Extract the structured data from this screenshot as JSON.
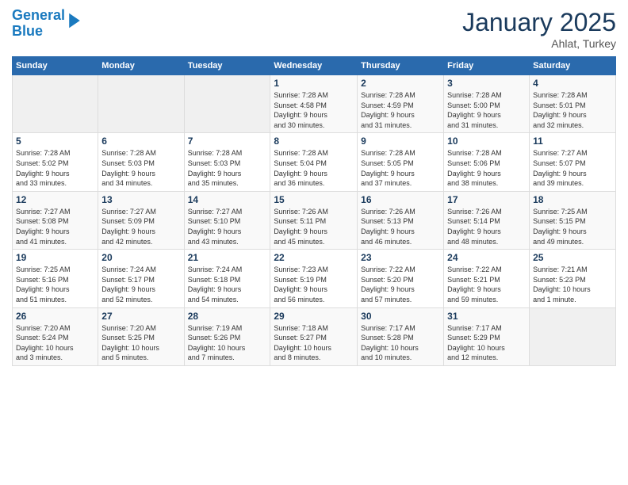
{
  "logo": {
    "line1": "General",
    "line2": "Blue"
  },
  "header": {
    "month": "January 2025",
    "location": "Ahlat, Turkey"
  },
  "days_of_week": [
    "Sunday",
    "Monday",
    "Tuesday",
    "Wednesday",
    "Thursday",
    "Friday",
    "Saturday"
  ],
  "weeks": [
    [
      {
        "day": "",
        "info": ""
      },
      {
        "day": "",
        "info": ""
      },
      {
        "day": "",
        "info": ""
      },
      {
        "day": "1",
        "info": "Sunrise: 7:28 AM\nSunset: 4:58 PM\nDaylight: 9 hours\nand 30 minutes."
      },
      {
        "day": "2",
        "info": "Sunrise: 7:28 AM\nSunset: 4:59 PM\nDaylight: 9 hours\nand 31 minutes."
      },
      {
        "day": "3",
        "info": "Sunrise: 7:28 AM\nSunset: 5:00 PM\nDaylight: 9 hours\nand 31 minutes."
      },
      {
        "day": "4",
        "info": "Sunrise: 7:28 AM\nSunset: 5:01 PM\nDaylight: 9 hours\nand 32 minutes."
      }
    ],
    [
      {
        "day": "5",
        "info": "Sunrise: 7:28 AM\nSunset: 5:02 PM\nDaylight: 9 hours\nand 33 minutes."
      },
      {
        "day": "6",
        "info": "Sunrise: 7:28 AM\nSunset: 5:03 PM\nDaylight: 9 hours\nand 34 minutes."
      },
      {
        "day": "7",
        "info": "Sunrise: 7:28 AM\nSunset: 5:03 PM\nDaylight: 9 hours\nand 35 minutes."
      },
      {
        "day": "8",
        "info": "Sunrise: 7:28 AM\nSunset: 5:04 PM\nDaylight: 9 hours\nand 36 minutes."
      },
      {
        "day": "9",
        "info": "Sunrise: 7:28 AM\nSunset: 5:05 PM\nDaylight: 9 hours\nand 37 minutes."
      },
      {
        "day": "10",
        "info": "Sunrise: 7:28 AM\nSunset: 5:06 PM\nDaylight: 9 hours\nand 38 minutes."
      },
      {
        "day": "11",
        "info": "Sunrise: 7:27 AM\nSunset: 5:07 PM\nDaylight: 9 hours\nand 39 minutes."
      }
    ],
    [
      {
        "day": "12",
        "info": "Sunrise: 7:27 AM\nSunset: 5:08 PM\nDaylight: 9 hours\nand 41 minutes."
      },
      {
        "day": "13",
        "info": "Sunrise: 7:27 AM\nSunset: 5:09 PM\nDaylight: 9 hours\nand 42 minutes."
      },
      {
        "day": "14",
        "info": "Sunrise: 7:27 AM\nSunset: 5:10 PM\nDaylight: 9 hours\nand 43 minutes."
      },
      {
        "day": "15",
        "info": "Sunrise: 7:26 AM\nSunset: 5:11 PM\nDaylight: 9 hours\nand 45 minutes."
      },
      {
        "day": "16",
        "info": "Sunrise: 7:26 AM\nSunset: 5:13 PM\nDaylight: 9 hours\nand 46 minutes."
      },
      {
        "day": "17",
        "info": "Sunrise: 7:26 AM\nSunset: 5:14 PM\nDaylight: 9 hours\nand 48 minutes."
      },
      {
        "day": "18",
        "info": "Sunrise: 7:25 AM\nSunset: 5:15 PM\nDaylight: 9 hours\nand 49 minutes."
      }
    ],
    [
      {
        "day": "19",
        "info": "Sunrise: 7:25 AM\nSunset: 5:16 PM\nDaylight: 9 hours\nand 51 minutes."
      },
      {
        "day": "20",
        "info": "Sunrise: 7:24 AM\nSunset: 5:17 PM\nDaylight: 9 hours\nand 52 minutes."
      },
      {
        "day": "21",
        "info": "Sunrise: 7:24 AM\nSunset: 5:18 PM\nDaylight: 9 hours\nand 54 minutes."
      },
      {
        "day": "22",
        "info": "Sunrise: 7:23 AM\nSunset: 5:19 PM\nDaylight: 9 hours\nand 56 minutes."
      },
      {
        "day": "23",
        "info": "Sunrise: 7:22 AM\nSunset: 5:20 PM\nDaylight: 9 hours\nand 57 minutes."
      },
      {
        "day": "24",
        "info": "Sunrise: 7:22 AM\nSunset: 5:21 PM\nDaylight: 9 hours\nand 59 minutes."
      },
      {
        "day": "25",
        "info": "Sunrise: 7:21 AM\nSunset: 5:23 PM\nDaylight: 10 hours\nand 1 minute."
      }
    ],
    [
      {
        "day": "26",
        "info": "Sunrise: 7:20 AM\nSunset: 5:24 PM\nDaylight: 10 hours\nand 3 minutes."
      },
      {
        "day": "27",
        "info": "Sunrise: 7:20 AM\nSunset: 5:25 PM\nDaylight: 10 hours\nand 5 minutes."
      },
      {
        "day": "28",
        "info": "Sunrise: 7:19 AM\nSunset: 5:26 PM\nDaylight: 10 hours\nand 7 minutes."
      },
      {
        "day": "29",
        "info": "Sunrise: 7:18 AM\nSunset: 5:27 PM\nDaylight: 10 hours\nand 8 minutes."
      },
      {
        "day": "30",
        "info": "Sunrise: 7:17 AM\nSunset: 5:28 PM\nDaylight: 10 hours\nand 10 minutes."
      },
      {
        "day": "31",
        "info": "Sunrise: 7:17 AM\nSunset: 5:29 PM\nDaylight: 10 hours\nand 12 minutes."
      },
      {
        "day": "",
        "info": ""
      }
    ]
  ]
}
